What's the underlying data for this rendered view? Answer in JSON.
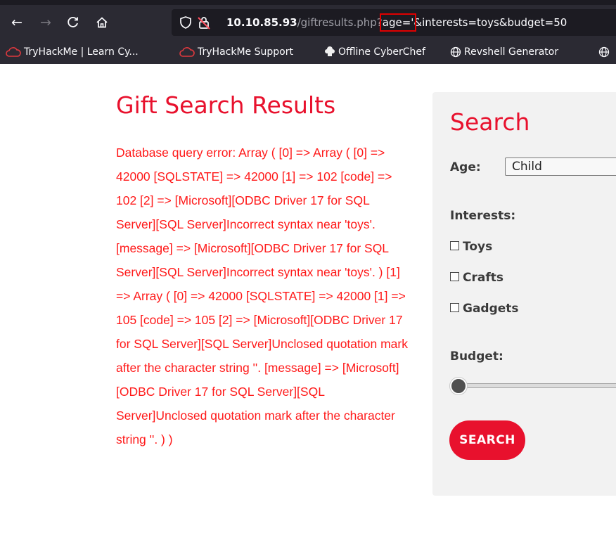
{
  "browser": {
    "url": {
      "host": "10.10.85.93",
      "path": "/giftresults.php?",
      "highlighted_param": "age='",
      "rest": "&interests=toys&budget=50"
    },
    "bookmarks": [
      {
        "label": "TryHackMe | Learn Cy...",
        "icon": "tryhackme-cloud-icon"
      },
      {
        "label": "TryHackMe Support",
        "icon": "tryhackme-cloud-icon"
      },
      {
        "label": "Offline CyberChef",
        "icon": "chef-hat-icon"
      },
      {
        "label": "Revshell Generator",
        "icon": "globe-icon"
      }
    ]
  },
  "page": {
    "title": "Gift Search Results",
    "error_message": "Database query error: Array ( [0] => Array ( [0] => 42000 [SQLSTATE] => 42000 [1] => 102 [code] => 102 [2] => [Microsoft][ODBC Driver 17 for SQL Server][SQL Server]Incorrect syntax near 'toys'. [message] => [Microsoft][ODBC Driver 17 for SQL Server][SQL Server]Incorrect syntax near 'toys'. ) [1] => Array ( [0] => 42000 [SQLSTATE] => 42000 [1] => 105 [code] => 105 [2] => [Microsoft][ODBC Driver 17 for SQL Server][SQL Server]Unclosed quotation mark after the character string ''. [message] => [Microsoft][ODBC Driver 17 for SQL Server][SQL Server]Unclosed quotation mark after the character string ''. ) )"
  },
  "search": {
    "heading": "Search",
    "age_label": "Age:",
    "age_value": "Child",
    "interests_label": "Interests:",
    "interests": [
      {
        "label": "Toys",
        "checked": false
      },
      {
        "label": "Crafts",
        "checked": false
      },
      {
        "label": "Gadgets",
        "checked": false
      }
    ],
    "budget_label": "Budget:",
    "button_label": "SEARCH"
  },
  "colors": {
    "accent": "#e8112d",
    "error_text": "#ff1a1a",
    "panel_bg": "#f2f2f2",
    "chrome_bg": "#2b2a33"
  }
}
